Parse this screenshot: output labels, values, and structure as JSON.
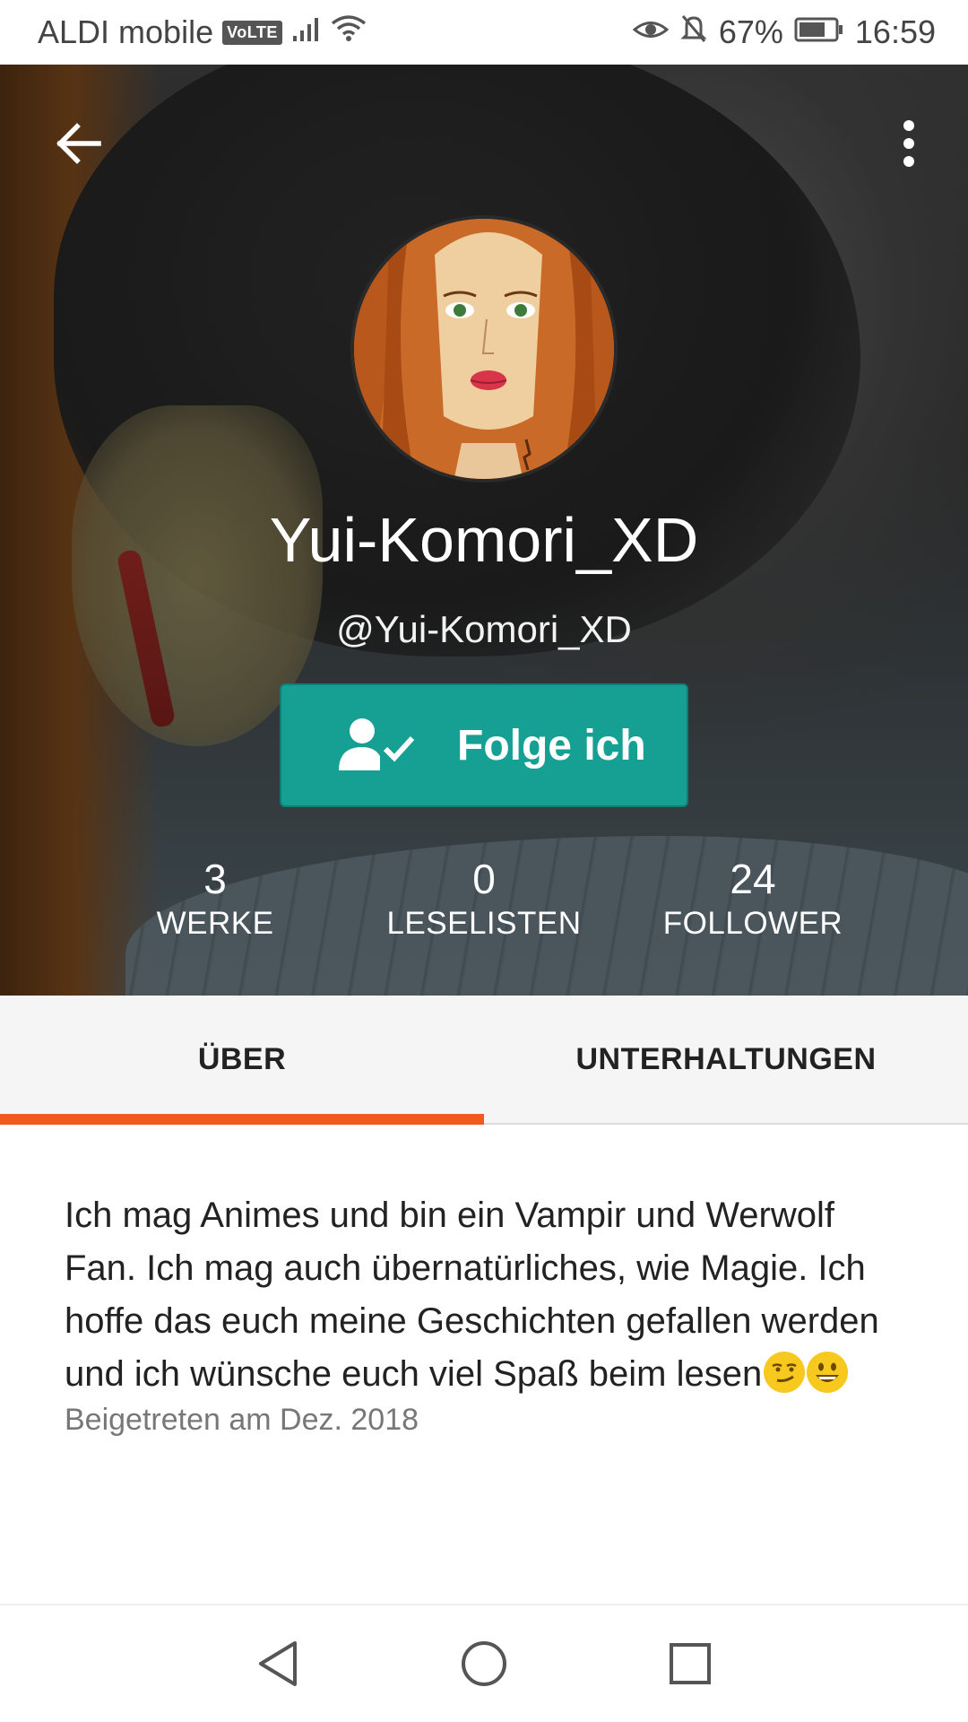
{
  "status_bar": {
    "carrier": "ALDI mobile",
    "volte": "VoLTE",
    "battery": "67%",
    "time": "16:59"
  },
  "header": {
    "display_name": "Yui-Komori_XD",
    "username": "@Yui-Komori_XD",
    "follow_label": "Folge ich",
    "icons": {
      "back": "arrow-left-icon",
      "more": "more-vertical-icon",
      "follow": "person-check-icon"
    }
  },
  "stats": [
    {
      "value": "3",
      "label": "WERKE"
    },
    {
      "value": "0",
      "label": "LESELISTEN"
    },
    {
      "value": "24",
      "label": "FOLLOWER"
    }
  ],
  "tabs": [
    {
      "label": "ÜBER",
      "active": true
    },
    {
      "label": "UNTERHALTUNGEN",
      "active": false
    }
  ],
  "about": {
    "text": "Ich mag Animes und bin ein Vampir und Werwolf Fan. Ich mag auch übernatürliches, wie Magie. Ich hoffe das euch meine Geschichten gefallen werden und ich wünsche euch viel Spaß beim lesen",
    "emojis": [
      "smirk-emoji",
      "grin-emoji"
    ],
    "joined": "Beigetreten am Dez. 2018"
  },
  "colors": {
    "accent": "#f05a1e",
    "follow_button": "#16a093"
  }
}
